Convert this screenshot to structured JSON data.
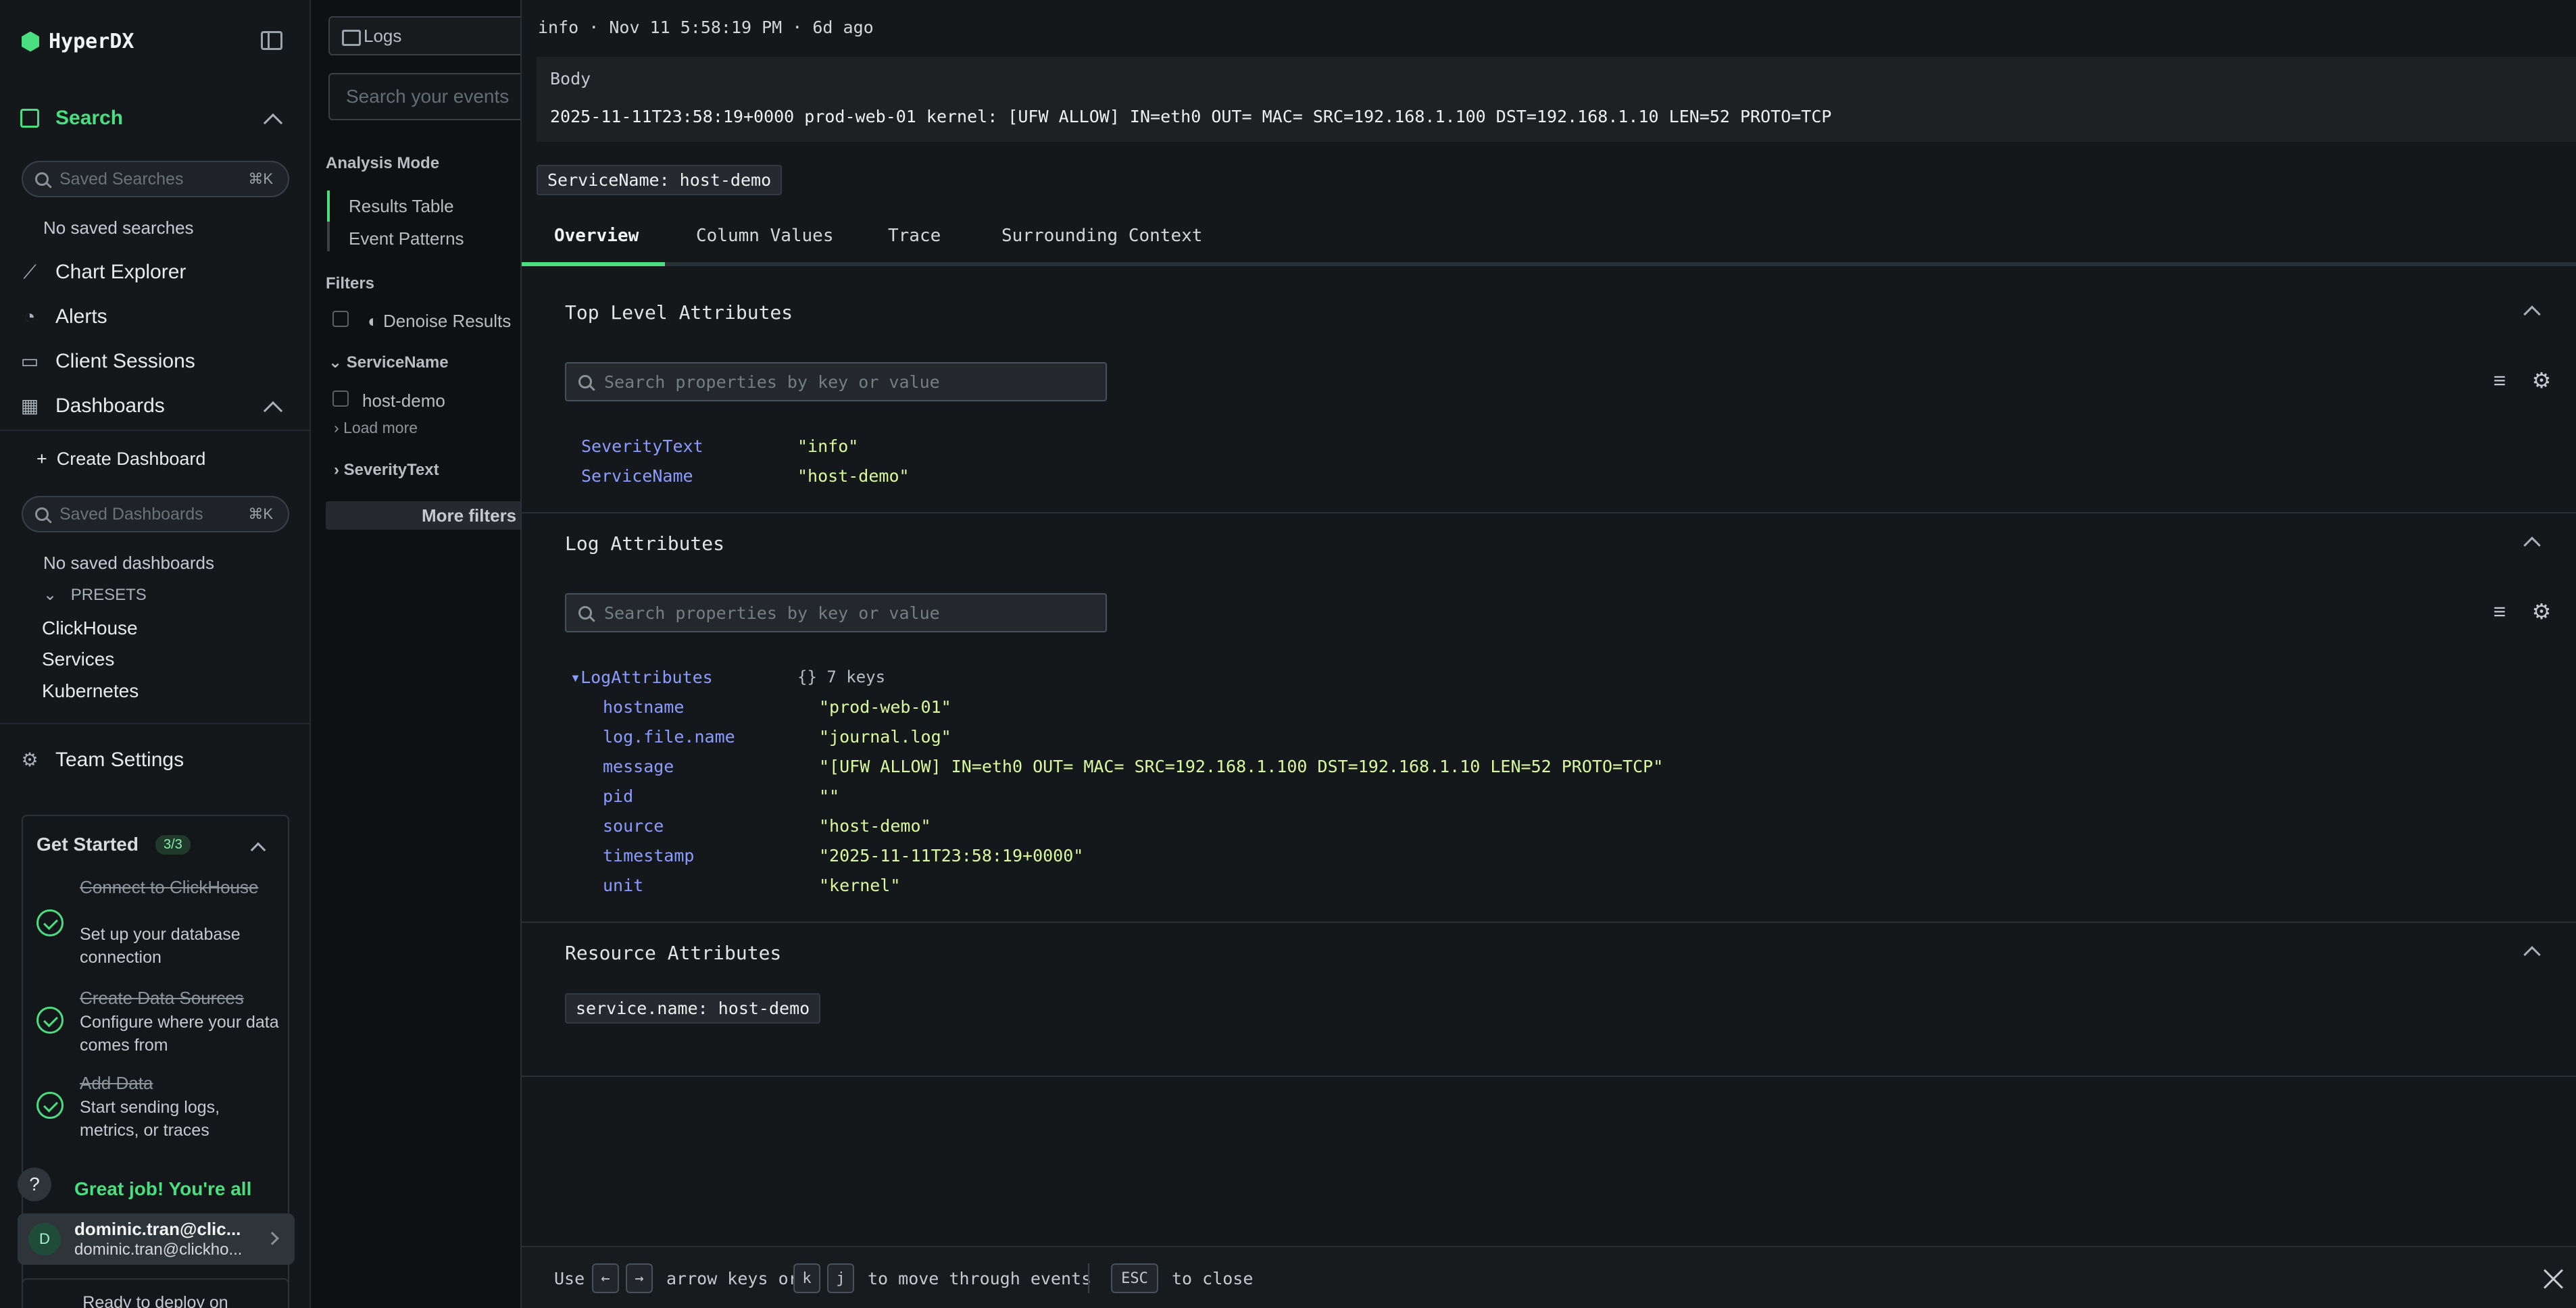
{
  "app": {
    "name": "HyperDX"
  },
  "sidebar": {
    "search_label": "Search",
    "saved_searches_placeholder": "Saved Searches",
    "saved_searches_shortcut": "⌘K",
    "no_saved_searches": "No saved searches",
    "chart_explorer": "Chart Explorer",
    "alerts": "Alerts",
    "client_sessions": "Client Sessions",
    "dashboards": "Dashboards",
    "create_dashboard": "Create Dashboard",
    "saved_dashboards_placeholder": "Saved Dashboards",
    "saved_dashboards_shortcut": "⌘K",
    "no_saved_dashboards": "No saved dashboards",
    "presets_label": "PRESETS",
    "presets": [
      "ClickHouse",
      "Services",
      "Kubernetes"
    ],
    "team_settings": "Team Settings"
  },
  "get_started": {
    "title": "Get Started",
    "progress": "3/3",
    "steps": [
      {
        "title": "Connect to ClickHouse",
        "desc": "Set up your database connection"
      },
      {
        "title": "Create Data Sources",
        "desc": "Configure where your data comes from"
      },
      {
        "title": "Add Data",
        "desc": "Start sending logs, metrics, or traces"
      }
    ],
    "completion": "Great job! You're all",
    "deploy": "Ready to deploy on"
  },
  "user": {
    "initial": "D",
    "name": "dominic.tran@clic...",
    "email": "dominic.tran@clickho..."
  },
  "middle": {
    "source": "Logs",
    "search_placeholder": "Search your events",
    "analysis_mode": "Analysis Mode",
    "results_table": "Results Table",
    "event_patterns": "Event Patterns",
    "filters": "Filters",
    "denoise": "Denoise Results",
    "service_name_group": "ServiceName",
    "service_value": "host-demo",
    "load_more": "Load more",
    "severity_group": "SeverityText",
    "more_filters": "More filters"
  },
  "detail": {
    "header": "info  ·  Nov 11 5:58:19 PM · 6d ago",
    "body_label": "Body",
    "body_text": "2025-11-11T23:58:19+0000 prod-web-01 kernel: [UFW ALLOW] IN=eth0 OUT= MAC= SRC=192.168.1.100 DST=192.168.1.10 LEN=52 PROTO=TCP",
    "service_tag": "ServiceName: host-demo",
    "tabs": [
      "Overview",
      "Column Values",
      "Trace",
      "Surrounding Context"
    ],
    "top_level": {
      "title": "Top Level Attributes",
      "placeholder": "Search properties by key or value",
      "rows": [
        {
          "key": "SeverityText",
          "value": "\"info\""
        },
        {
          "key": "ServiceName",
          "value": "\"host-demo\""
        }
      ]
    },
    "log_attributes": {
      "title": "Log Attributes",
      "placeholder": "Search properties by key or value",
      "group_key": "LogAttributes",
      "group_meta": "{} 7 keys",
      "rows": [
        {
          "key": "hostname",
          "value": "\"prod-web-01\""
        },
        {
          "key": "log.file.name",
          "value": "\"journal.log\""
        },
        {
          "key": "message",
          "value": "\"[UFW ALLOW] IN=eth0 OUT= MAC= SRC=192.168.1.100 DST=192.168.1.10 LEN=52 PROTO=TCP\""
        },
        {
          "key": "pid",
          "value": "\"\""
        },
        {
          "key": "source",
          "value": "\"host-demo\""
        },
        {
          "key": "timestamp",
          "value": "\"2025-11-11T23:58:19+0000\""
        },
        {
          "key": "unit",
          "value": "\"kernel\""
        }
      ]
    },
    "resource": {
      "title": "Resource Attributes",
      "tag": "service.name: host-demo"
    },
    "footer": {
      "use": "Use",
      "left_key": "←",
      "right_key": "→",
      "arrow_text": "arrow keys or",
      "k_key": "k",
      "j_key": "j",
      "move_text": "to move through events",
      "esc_key": "ESC",
      "close_text": "to close"
    }
  },
  "colors": {
    "accent": "#4ade80",
    "attr_key": "#8b9cff",
    "attr_value": "#d9f99d"
  }
}
